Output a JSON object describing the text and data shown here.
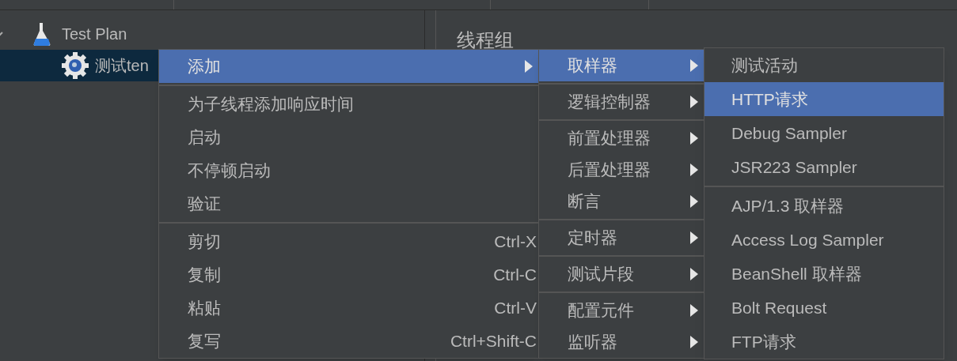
{
  "tree": {
    "items": [
      {
        "kind": "plan",
        "label": "Test Plan",
        "expanded": true,
        "selected": false,
        "children": [
          {
            "kind": "group",
            "label": "测试ten",
            "selected": true
          }
        ]
      }
    ]
  },
  "panel": {
    "title": "线程组"
  },
  "menus": [
    {
      "groups": [
        [
          {
            "label": "添加",
            "submenu": true,
            "selected": true
          }
        ],
        [
          {
            "label": "为子线程添加响应时间",
            "submenu": false,
            "selected": false
          },
          {
            "label": "启动",
            "submenu": false,
            "selected": false
          },
          {
            "label": "不停顿启动",
            "submenu": false,
            "selected": false
          },
          {
            "label": "验证",
            "submenu": false,
            "selected": false
          }
        ],
        [
          {
            "label": "剪切",
            "shortcut": "Ctrl-X",
            "submenu": false,
            "selected": false
          },
          {
            "label": "复制",
            "shortcut": "Ctrl-C",
            "submenu": false,
            "selected": false
          },
          {
            "label": "粘贴",
            "shortcut": "Ctrl-V",
            "submenu": false,
            "selected": false
          },
          {
            "label": "复写",
            "shortcut": "Ctrl+Shift-C",
            "submenu": false,
            "selected": false
          }
        ]
      ]
    },
    {
      "groups": [
        [
          {
            "label": "取样器",
            "submenu": true,
            "selected": true
          }
        ],
        [
          {
            "label": "逻辑控制器",
            "submenu": true,
            "selected": false
          }
        ],
        [
          {
            "label": "前置处理器",
            "submenu": true,
            "selected": false
          },
          {
            "label": "后置处理器",
            "submenu": true,
            "selected": false
          },
          {
            "label": "断言",
            "submenu": true,
            "selected": false
          }
        ],
        [
          {
            "label": "定时器",
            "submenu": true,
            "selected": false
          }
        ],
        [
          {
            "label": "测试片段",
            "submenu": true,
            "selected": false
          }
        ],
        [
          {
            "label": "配置元件",
            "submenu": true,
            "selected": false
          },
          {
            "label": "监听器",
            "submenu": true,
            "selected": false
          }
        ]
      ]
    },
    {
      "groups": [
        [
          {
            "label": "测试活动",
            "submenu": false,
            "selected": false
          },
          {
            "label": "HTTP请求",
            "submenu": false,
            "selected": true
          },
          {
            "label": "Debug Sampler",
            "submenu": false,
            "selected": false
          },
          {
            "label": "JSR223 Sampler",
            "submenu": false,
            "selected": false
          }
        ],
        [
          {
            "label": "AJP/1.3 取样器",
            "submenu": false,
            "selected": false
          },
          {
            "label": "Access Log Sampler",
            "submenu": false,
            "selected": false
          },
          {
            "label": "BeanShell 取样器",
            "submenu": false,
            "selected": false
          },
          {
            "label": "Bolt Request",
            "submenu": false,
            "selected": false
          },
          {
            "label": "FTP请求",
            "submenu": false,
            "selected": false
          }
        ]
      ]
    }
  ]
}
